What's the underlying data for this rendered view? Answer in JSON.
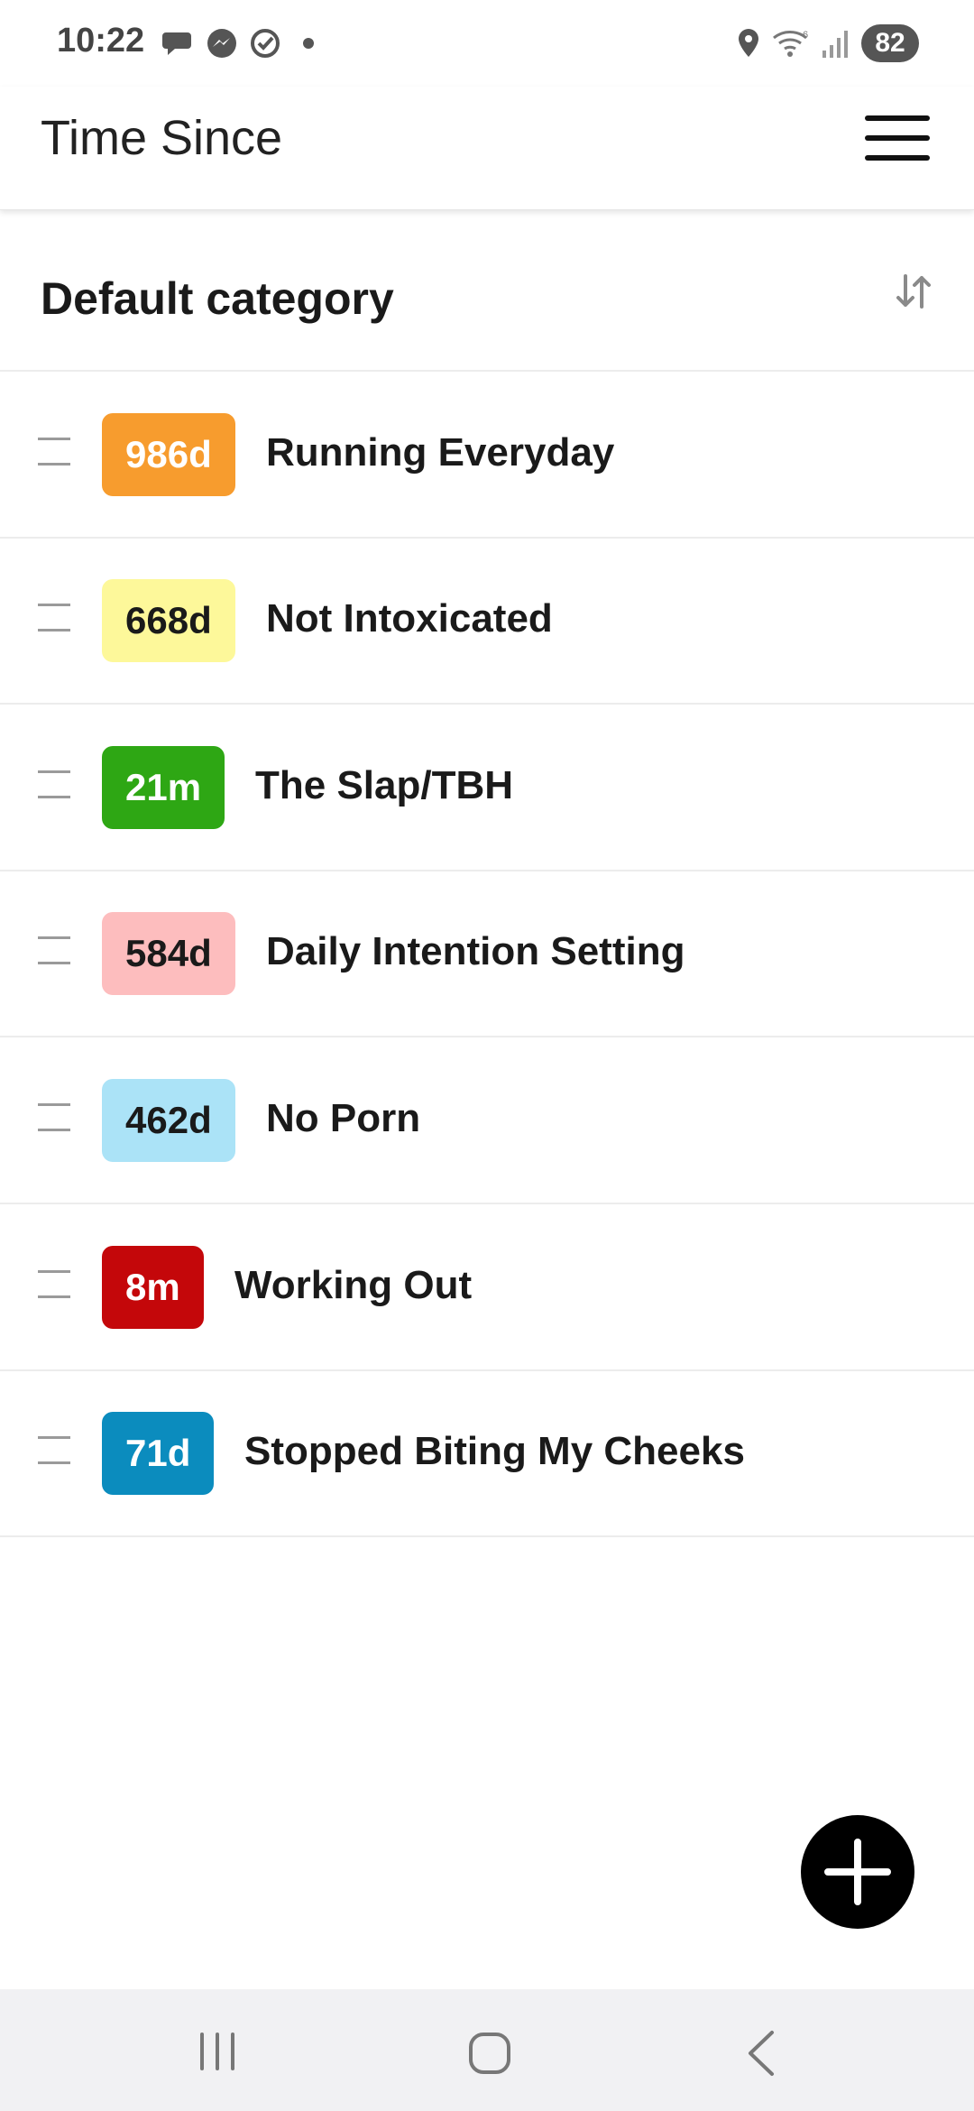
{
  "status_bar": {
    "time": "10:22",
    "battery": "82",
    "notification_icons": [
      "chat-bubble-icon",
      "messenger-icon",
      "check-circle-icon",
      "dot-icon"
    ],
    "system_icons": [
      "location-icon",
      "wifi-icon",
      "signal-icon"
    ]
  },
  "app_bar": {
    "title": "Time Since",
    "menu_icon": "hamburger-menu-icon"
  },
  "category": {
    "title": "Default category",
    "sort_icon": "sort-arrows-icon"
  },
  "items": [
    {
      "badge": "986d",
      "label": "Running Everyday",
      "badge_color": "#F79C2E",
      "badge_text_color": "#ffffff"
    },
    {
      "badge": "668d",
      "label": "Not Intoxicated",
      "badge_color": "#FDF89A",
      "badge_text_color": "#1a1a1a"
    },
    {
      "badge": "21m",
      "label": "The Slap/TBH",
      "badge_color": "#2EA714",
      "badge_text_color": "#ffffff"
    },
    {
      "badge": "584d",
      "label": "Daily Intention Setting",
      "badge_color": "#FDBDBE",
      "badge_text_color": "#1a1a1a"
    },
    {
      "badge": "462d",
      "label": "No Porn",
      "badge_color": "#ABE3F7",
      "badge_text_color": "#1a1a1a"
    },
    {
      "badge": "8m",
      "label": "Working Out",
      "badge_color": "#C4070A",
      "badge_text_color": "#ffffff"
    },
    {
      "badge": "71d",
      "label": "Stopped Biting My Cheeks",
      "badge_color": "#0B8CBE",
      "badge_text_color": "#ffffff"
    }
  ],
  "fab": {
    "icon": "plus-icon"
  },
  "nav_bar": {
    "icons": [
      "recent-apps-icon",
      "home-icon",
      "back-icon"
    ]
  }
}
